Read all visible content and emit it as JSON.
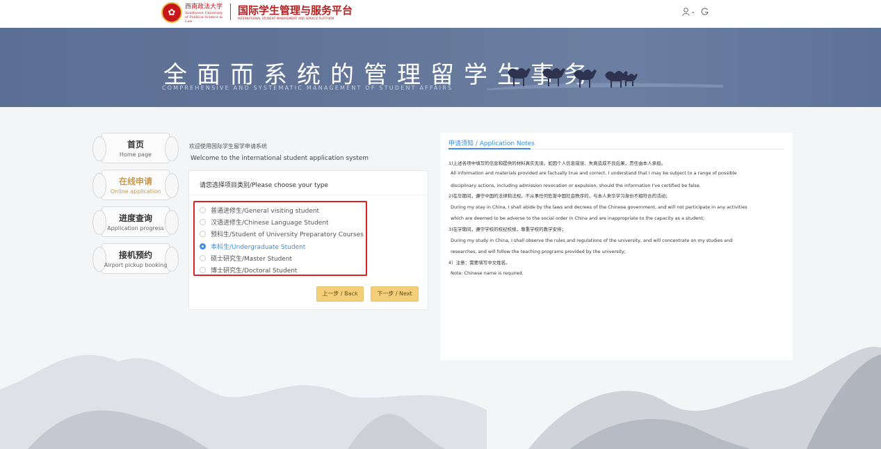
{
  "header": {
    "university_name": "西南政法大学",
    "university_en": "Southwest University of Political Science & Law",
    "platform_title": "国际学生管理与服务平台",
    "platform_subtitle": "INTERNATIONAL STUDENT MANAGEMENT AND SERVICE PLATFORM",
    "user_icon": "user-icon",
    "language_icon": "language-icon"
  },
  "banner": {
    "title": "全面而系统的管理留学生事务",
    "subtitle": "COMPREHENSIVE AND SYSTEMATIC MANAGEMENT OF STUDENT AFFAIRS"
  },
  "sidebar": {
    "items": [
      {
        "cn": "首页",
        "en": "Home page"
      },
      {
        "cn": "在线申请",
        "en": "Online application"
      },
      {
        "cn": "进度查询",
        "en": "Application progress"
      },
      {
        "cn": "接机预约",
        "en": "Airport pickup booking"
      }
    ]
  },
  "welcome": {
    "cn": "欢迎使用国际学生留学申请系统",
    "en": "Welcome to the international student application system"
  },
  "type_card": {
    "header": "请您选择项目类别/Please choose your type",
    "options": [
      "普通进修生/General visiting student",
      "汉语进修生/Chinese Language Student",
      "预科生/Student of University Preparatory Courses",
      "本科生/Undergraduate Student",
      "硕士研究生/Master Student",
      "博士研究生/Doctoral Student"
    ],
    "selected": "本科生/Undergraduate Student",
    "back_label": "上一步 / Back",
    "next_label": "下一步 / Next"
  },
  "notes": {
    "tab": "申请须知 / Application Notes",
    "lines": [
      "1)上述各项中填写的信息和提供的材料真实无误。如因个人信息错误、失真造成不良后果，责任由本人承担。",
      "All information and materials provided are factually true and correct. I understand that I may be subject to a range of possible",
      "disciplinary actions, including admission revocation or expulsion, should the information I've certified be false.",
      "2)在华期间，遵守中国的法律和法规，不从事任何危害中国社会秩序的，与本人来华学习身份不相符合的活动；",
      "During my stay in China, I shall abide by the laws and decrees of the Chinese government, and will not participate in any activities",
      "which are deemed to be adverse to the social order in China and are inappropriate to the capacity as a student;",
      "3)在学期间，遵守学校的校纪校规，尊重学校的教学安排；",
      "During my study in China, I shall observe the rules and regulations of the university, and will concentrate on my studies and",
      "researches, and will follow the teaching programs provided by the university;",
      "4）注意：需要填写中文姓名。",
      "Note: Chinese name is required."
    ]
  }
}
